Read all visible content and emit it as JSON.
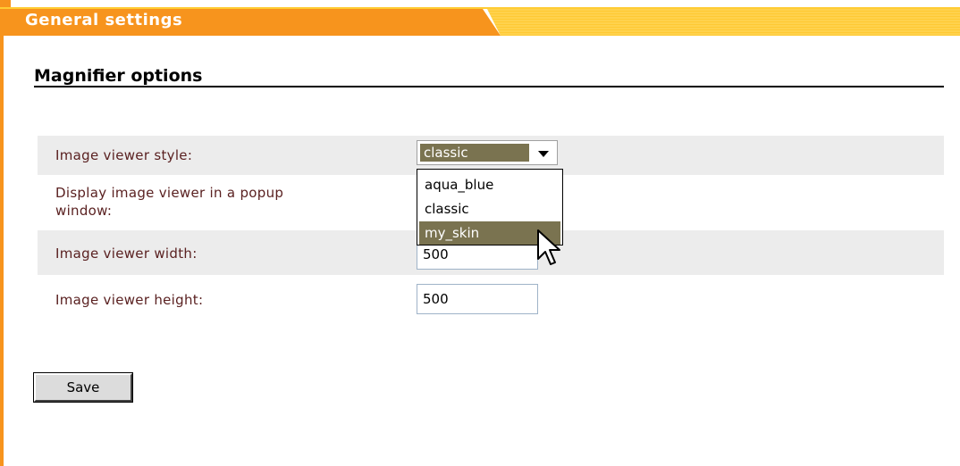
{
  "header": {
    "title": "General settings"
  },
  "section": {
    "title": "Magnifier options"
  },
  "form": {
    "viewer_style": {
      "label": "Image viewer style:",
      "selected": "classic",
      "options": [
        "aqua_blue",
        "classic",
        "my_skin"
      ],
      "highlighted": "my_skin"
    },
    "popup": {
      "label_line1": "Display image viewer in a popup",
      "label_line2": "window:"
    },
    "width": {
      "label": "Image viewer width:",
      "value": "500"
    },
    "height": {
      "label": "Image viewer height:",
      "value": "500"
    }
  },
  "buttons": {
    "save_label": "Save"
  },
  "colors": {
    "accent": "#f7941d",
    "header_stripe": "#ffcc33",
    "label_text": "#5a2121",
    "selection": "#7a7350"
  },
  "icons": {
    "cursor": "arrow-cursor-icon",
    "dropdown_arrow": "chevron-down-icon"
  }
}
